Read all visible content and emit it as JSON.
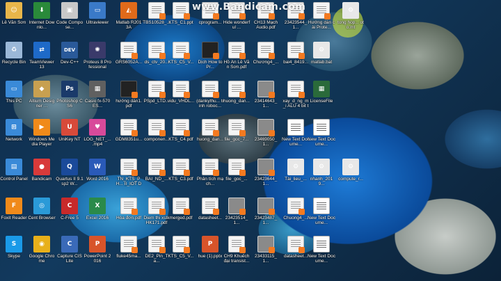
{
  "watermark": "www.Bandicam.com",
  "icons": [
    {
      "label": "Lê Văn Sơn",
      "icon": "user-folder-icon",
      "color": "#e8b64a",
      "style": "plain"
    },
    {
      "label": "Internet Downlo...",
      "icon": "idm-icon",
      "color": "#2a8a3a",
      "style": "plain"
    },
    {
      "label": "Code Compose...",
      "icon": "cube-icon",
      "color": "#c8c8c8",
      "style": "plain"
    },
    {
      "label": "Ultraviewer",
      "icon": "monitor-icon",
      "color": "#3a7ac8",
      "style": "plain"
    },
    {
      "label": "Matlab R2013A",
      "icon": "matlab-icon",
      "color": "#e06a1a",
      "style": "plain"
    },
    {
      "label": "TBS10528_...",
      "icon": "pdf-doc-icon",
      "color": "#f4f4f4",
      "style": "pdf"
    },
    {
      "label": "KTS_C1.ppt",
      "icon": "pdf-doc-icon",
      "color": "#f4f4f4",
      "style": "pdf"
    },
    {
      "label": "cprogram...",
      "icon": "pdf-doc-icon",
      "color": "#f4f4f4",
      "style": "pdf"
    },
    {
      "label": "Hide wonderful ...",
      "icon": "image-icon",
      "color": "#f4f4f4",
      "style": "pdf"
    },
    {
      "label": "CH13 Mạch Audio.pdf",
      "icon": "pdf-doc-icon",
      "color": "#f4f4f4",
      "style": "pdf"
    },
    {
      "label": "23423544_1...",
      "icon": "pdf-doc-icon",
      "color": "#f4f4f4",
      "style": "pdf"
    },
    {
      "label": "Hướng dẫn cài Prote...",
      "icon": "pdf-doc-icon",
      "color": "#f4f4f4",
      "style": "pdf"
    },
    {
      "label": "tong hop... oto.mt",
      "icon": "settings-file-icon",
      "color": "#e8e8e8",
      "style": "plain"
    },
    {
      "label": "Recycle Bin",
      "icon": "recycle-bin-icon",
      "color": "#9ab8d8",
      "style": "plain"
    },
    {
      "label": "TeamViewer 13",
      "icon": "teamviewer-icon",
      "color": "#1e6ac8",
      "style": "circle"
    },
    {
      "label": "Dev-C++",
      "icon": "dev-cpp-icon",
      "color": "#2a5a9a",
      "style": "plain"
    },
    {
      "label": "Proteus 8 Professional",
      "icon": "proteus-icon",
      "color": "#3a3a6a",
      "style": "plain"
    },
    {
      "label": "GRS6052A...",
      "icon": "pdf-doc-icon",
      "color": "#f4f4f4",
      "style": "pdf"
    },
    {
      "label": "ds_ctv_20...",
      "icon": "pdf-doc-icon",
      "color": "#f4f4f4",
      "style": "pdf"
    },
    {
      "label": "KTS_C5_V...",
      "icon": "pdf-doc-icon",
      "color": "#f4f4f4",
      "style": "pdf"
    },
    {
      "label": "Dịch How to Pr...",
      "icon": "pdf-doc-icon",
      "color": "#3a3a3a",
      "style": "dark"
    },
    {
      "label": "Hồ Án Lê Văn Sơn.pdf",
      "icon": "pdf-doc-icon",
      "color": "#f4f4f4",
      "style": "pdf"
    },
    {
      "label": "Chương4_...",
      "icon": "pdf-doc-icon",
      "color": "#f4f4f4",
      "style": "pdf"
    },
    {
      "label": "bai4_8419...",
      "icon": "pdf-doc-icon",
      "color": "#f4f4f4",
      "style": "pdf"
    },
    {
      "label": "matlab.bat",
      "icon": "settings-file-icon",
      "color": "#e8e8e8",
      "style": "plain"
    },
    {
      "label": "This PC",
      "icon": "this-pc-icon",
      "color": "#3a8ad8",
      "style": "plain"
    },
    {
      "label": "Altium Designer ...",
      "icon": "altium-icon",
      "color": "#c8a050",
      "style": "plain"
    },
    {
      "label": "Photoshop CS6",
      "icon": "photoshop-icon",
      "color": "#1a3a6a",
      "style": "plain"
    },
    {
      "label": "Casio fx-570ES...",
      "icon": "calculator-icon",
      "color": "#606060",
      "style": "plain"
    },
    {
      "label": "hướng dẫn1.pdf",
      "icon": "pdf-doc-icon",
      "color": "#3a3a3a",
      "style": "dark"
    },
    {
      "label": "PSpd_LTD...",
      "icon": "pdf-doc-icon",
      "color": "#f4f4f4",
      "style": "pdf"
    },
    {
      "label": "vidu_VHDL...",
      "icon": "pdf-doc-icon",
      "color": "#f4f4f4",
      "style": "pdf"
    },
    {
      "label": "(dankythu... trinh roboc...",
      "icon": "pdf-doc-icon",
      "color": "#f4f4f4",
      "style": "pdf"
    },
    {
      "label": "huong_dan...",
      "icon": "pdf-doc-icon",
      "color": "#f4f4f4",
      "style": "pdf"
    },
    {
      "label": "23414643_1...",
      "icon": "pdf-doc-icon",
      "color": "#8a8a8a",
      "style": "gray"
    },
    {
      "label": "xay_d_ng_m_i ALU 4 bit th...",
      "icon": "pdf-doc-icon",
      "color": "#f4f4f4",
      "style": "pdf"
    },
    {
      "label": "LicenseFile",
      "icon": "license-icon",
      "color": "#2a6a3a",
      "style": "plain"
    },
    {
      "label": "Network",
      "icon": "network-icon",
      "color": "#3a8ad8",
      "style": "plain"
    },
    {
      "label": "Windows Media Player",
      "icon": "media-player-icon",
      "color": "#f08a1a",
      "style": "circle"
    },
    {
      "label": "UniKey NT",
      "icon": "unikey-icon",
      "color": "#d84a3a",
      "style": "plain"
    },
    {
      "label": "LOG_NET_... .mp4",
      "icon": "video-icon",
      "color": "#d84a9a",
      "style": "plain"
    },
    {
      "label": "GDM8351u...",
      "icon": "pdf-doc-icon",
      "color": "#f4f4f4",
      "style": "pdf"
    },
    {
      "label": "componen...",
      "icon": "pdf-doc-icon",
      "color": "#f4f4f4",
      "style": "pdf"
    },
    {
      "label": "KTS_C4.pdf",
      "icon": "pdf-doc-icon",
      "color": "#f4f4f4",
      "style": "pdf"
    },
    {
      "label": "huong_dan...",
      "icon": "pdf-doc-icon",
      "color": "#f4f4f4",
      "style": "pdf"
    },
    {
      "label": "file_goc_7...",
      "icon": "pdf-doc-icon",
      "color": "#f4f4f4",
      "style": "pdf"
    },
    {
      "label": "23469050_1...",
      "icon": "pdf-doc-icon",
      "color": "#8a8a8a",
      "style": "gray"
    },
    {
      "label": "New Text Docume...",
      "icon": "text-document-icon",
      "color": "#ffffff",
      "style": "txt"
    },
    {
      "label": "New Text Docume...",
      "icon": "text-document-icon",
      "color": "#ffffff",
      "style": "txt"
    },
    {
      "label": "Control Panel",
      "icon": "control-panel-icon",
      "color": "#3a8ad8",
      "style": "plain"
    },
    {
      "label": "Bandicam",
      "icon": "bandicam-icon",
      "color": "#d83a3a",
      "style": "circle"
    },
    {
      "label": "Quartus II 9.1sp2 W...",
      "icon": "quartus-icon",
      "color": "#1a4a9a",
      "style": "plain"
    },
    {
      "label": "Word 2016",
      "icon": "word-icon",
      "color": "#2a5ab8",
      "style": "plain"
    },
    {
      "label": "TN_KTS_PH... II_IOT DE2...",
      "icon": "pdf-doc-icon",
      "color": "#f4f4f4",
      "style": "pdf"
    },
    {
      "label": "BAI_ND_...",
      "icon": "pdf-doc-icon",
      "color": "#f4f4f4",
      "style": "pdf"
    },
    {
      "label": "KTS_C3.pdf",
      "icon": "pdf-doc-icon",
      "color": "#f4f4f4",
      "style": "pdf"
    },
    {
      "label": "Phân tích mạch...",
      "icon": "pdf-doc-icon",
      "color": "#f4f4f4",
      "style": "pdf"
    },
    {
      "label": "file_goc_...",
      "icon": "pdf-doc-icon",
      "color": "#f4f4f4",
      "style": "pdf"
    },
    {
      "label": "23423644_1...",
      "icon": "pdf-doc-icon",
      "color": "#8a8a8a",
      "style": "gray"
    },
    {
      "label": "Tài_lieu_...",
      "icon": "settings-file-icon",
      "color": "#e8e8e8",
      "style": "plain"
    },
    {
      "label": "nhanh_2019...",
      "icon": "settings-file-icon",
      "color": "#e8e8e8",
      "style": "plain"
    },
    {
      "label": "compute_r...",
      "icon": "settings-file-icon",
      "color": "#e8e8e8",
      "style": "plain"
    },
    {
      "label": "Foxit Reader",
      "icon": "foxit-icon",
      "color": "#f08a1a",
      "style": "plain"
    },
    {
      "label": "Cent Browser",
      "icon": "cent-browser-icon",
      "color": "#2a9ad8",
      "style": "circle"
    },
    {
      "label": "C-Free 5",
      "icon": "cfree-icon",
      "color": "#c82a2a",
      "style": "plain"
    },
    {
      "label": "Excel 2016",
      "icon": "excel-icon",
      "color": "#2a8a4a",
      "style": "plain"
    },
    {
      "label": "Hóa đơn.pdf",
      "icon": "pdf-doc-icon",
      "color": "#f4f4f4",
      "style": "pdf"
    },
    {
      "label": "Diem thi xstk HK171.pdf",
      "icon": "pdf-doc-icon",
      "color": "#f4f4f4",
      "style": "pdf"
    },
    {
      "label": "merged.pdf",
      "icon": "pdf-doc-icon",
      "color": "#f4f4f4",
      "style": "pdf"
    },
    {
      "label": "datasheet...",
      "icon": "pdf-doc-icon",
      "color": "#f4f4f4",
      "style": "pdf"
    },
    {
      "label": "23423514_1...",
      "icon": "pdf-doc-icon",
      "color": "#8a8a8a",
      "style": "gray"
    },
    {
      "label": "23423487_1...",
      "icon": "pdf-doc-icon",
      "color": "#8a8a8a",
      "style": "gray"
    },
    {
      "label": "Chuong4_...",
      "icon": "pdf-doc-icon",
      "color": "#f4f4f4",
      "style": "pdf"
    },
    {
      "label": "New Text Docume...",
      "icon": "text-document-icon",
      "color": "#ffffff",
      "style": "txt"
    },
    {
      "label": "Skype",
      "icon": "skype-icon",
      "color": "#1a9ae8",
      "style": "plain"
    },
    {
      "label": "Google Chrome",
      "icon": "chrome-icon",
      "color": "#e8b01a",
      "style": "circle"
    },
    {
      "label": "Capture CIS Lite",
      "icon": "capture-icon",
      "color": "#3a6ab8",
      "style": "plain"
    },
    {
      "label": "PowerPoint 2016",
      "icon": "powerpoint-icon",
      "color": "#d8542a",
      "style": "plain"
    },
    {
      "label": "fluke45ma...",
      "icon": "pdf-doc-icon",
      "color": "#f4f4f4",
      "style": "pdf"
    },
    {
      "label": "DE2_Pin_Ta...",
      "icon": "pdf-doc-icon",
      "color": "#f4f4f4",
      "style": "pdf"
    },
    {
      "label": "KTS_C5_V...",
      "icon": "pdf-doc-icon",
      "color": "#f4f4f4",
      "style": "pdf"
    },
    {
      "label": "hue (1).pptx",
      "icon": "powerpoint-icon",
      "color": "#d8542a",
      "style": "plain"
    },
    {
      "label": "CH9 Khuếch đại transist...",
      "icon": "pdf-doc-icon",
      "color": "#f4f4f4",
      "style": "pdf"
    },
    {
      "label": "23433115_1...",
      "icon": "pdf-doc-icon",
      "color": "#8a8a8a",
      "style": "gray"
    },
    {
      "label": "datasheet...",
      "icon": "pdf-doc-icon",
      "color": "#f4f4f4",
      "style": "pdf"
    },
    {
      "label": "New Text Docume...",
      "icon": "text-document-icon",
      "color": "#ffffff",
      "style": "txt"
    }
  ],
  "glyph_text": {
    "idm-icon": "⬇",
    "cube-icon": "▣",
    "monitor-icon": "▭",
    "matlab-icon": "◭",
    "recycle-bin-icon": "♻",
    "teamviewer-icon": "⇄",
    "dev-cpp-icon": "DEV",
    "proteus-icon": "✺",
    "this-pc-icon": "▭",
    "altium-icon": "◆",
    "photoshop-icon": "Ps",
    "calculator-icon": "▦",
    "network-icon": "⊞",
    "media-player-icon": "▶",
    "unikey-icon": "U",
    "video-icon": "♥",
    "control-panel-icon": "▤",
    "bandicam-icon": "●",
    "quartus-icon": "Q",
    "word-icon": "W",
    "foxit-icon": "F",
    "cent-browser-icon": "◎",
    "cfree-icon": "C",
    "excel-icon": "X",
    "skype-icon": "S",
    "chrome-icon": "◉",
    "capture-icon": "C",
    "powerpoint-icon": "P",
    "license-icon": "▦",
    "settings-file-icon": "⚙",
    "user-folder-icon": "☺",
    "image-icon": "▨"
  }
}
